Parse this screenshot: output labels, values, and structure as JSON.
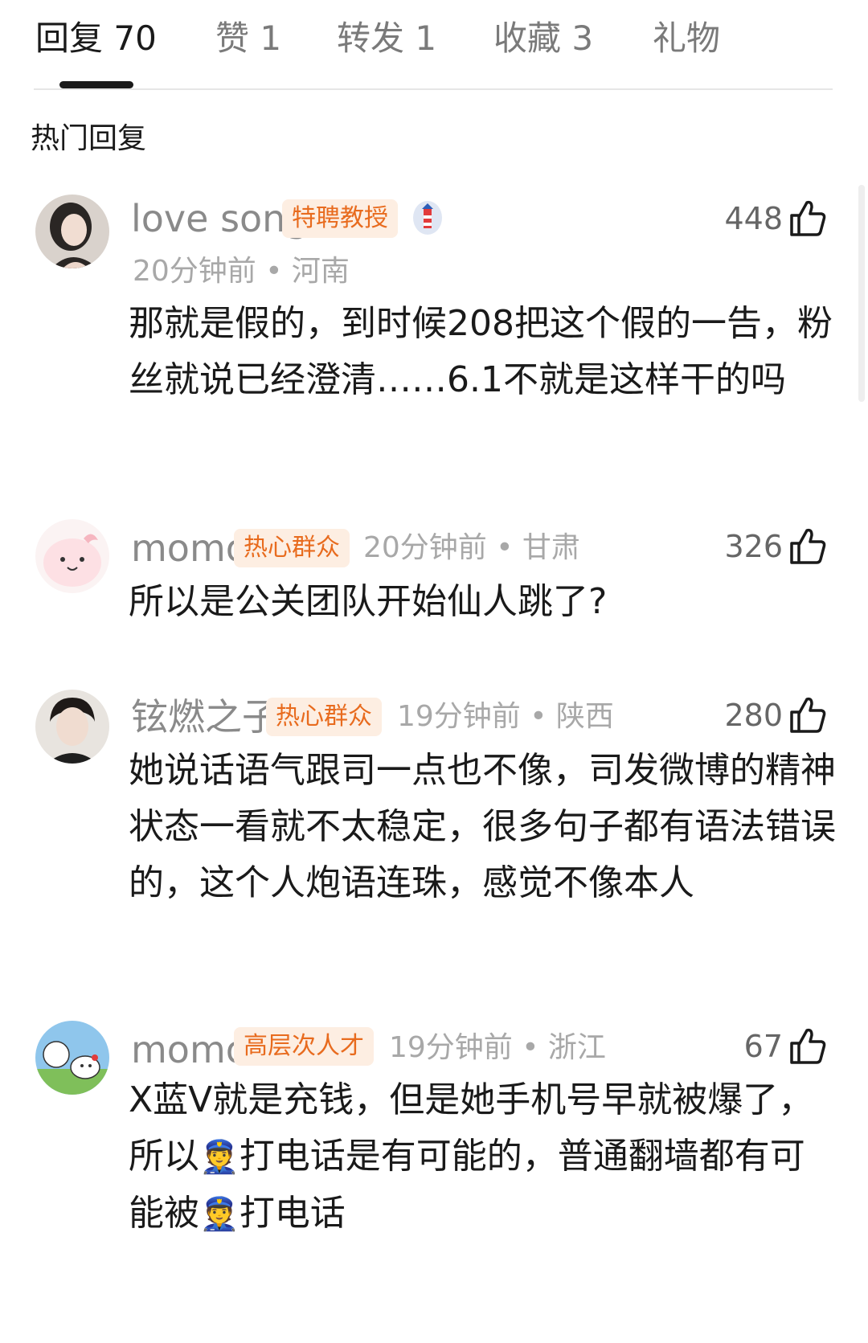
{
  "tabs": [
    {
      "label": "回复 70",
      "active": true
    },
    {
      "label": "赞 1",
      "active": false
    },
    {
      "label": "转发 1",
      "active": false
    },
    {
      "label": "收藏 3",
      "active": false
    },
    {
      "label": "礼物",
      "active": false
    }
  ],
  "section_title": "热门回复",
  "comments": [
    {
      "user": "love song",
      "badge": "特聘教授",
      "meta": "20分钟前 • 河南",
      "likes": "448",
      "text": "那就是假的，到时候208把这个假的一告，粉丝就说已经澄清……6.1不就是这样干的吗"
    },
    {
      "user": "momo",
      "badge": "热心群众",
      "meta": "20分钟前 • 甘肃",
      "likes": "326",
      "text": "所以是公关团队开始仙人跳了?"
    },
    {
      "user": "铉燃之子",
      "badge": "热心群众",
      "meta": "19分钟前 • 陕西",
      "likes": "280",
      "text": "她说话语气跟司一点也不像，司发微博的精神状态一看就不太稳定，很多句子都有语法错误的，这个人炮语连珠，感觉不像本人"
    },
    {
      "user": "momo",
      "badge": "高层次人才",
      "meta": "19分钟前 • 浙江",
      "likes": "67",
      "text_parts": [
        "X蓝V就是充钱，但是她手机号早就被爆了，所以",
        "👮",
        "打电话是有可能的，普通翻墙都有可能被",
        "👮",
        "打电话"
      ]
    }
  ],
  "colors": {
    "badge_text": "#e86b1e",
    "badge_bg": "#fdeee2",
    "muted": "#8a8a8a",
    "text": "#1a1a1a"
  },
  "icons": {
    "like": "thumbs-up-icon",
    "level": "lighthouse-level-icon"
  }
}
